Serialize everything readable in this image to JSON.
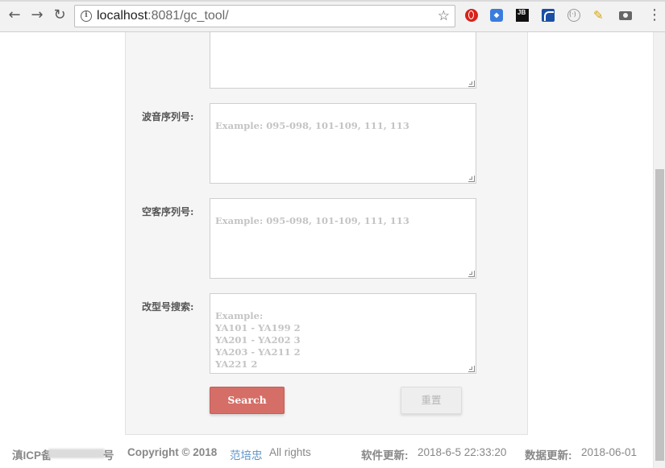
{
  "browser": {
    "url_host": "localhost",
    "url_rest": ":8081/gc_tool/",
    "extensions": [
      "opera-icon",
      "blue-extension-icon",
      "jetbrains-icon",
      "wave-extension-icon",
      "circle-extension-icon",
      "pen-extension-icon",
      "camera-icon"
    ],
    "jb_label": "JB"
  },
  "form": {
    "fields": [
      {
        "label": "",
        "placeholder": ""
      },
      {
        "label": "波音序列号:",
        "placeholder": "Example: 095-098, 101-109, 111, 113"
      },
      {
        "label": "空客序列号:",
        "placeholder": "Example: 095-098, 101-109, 111, 113"
      },
      {
        "label": "改型号搜索:",
        "placeholder": "Example:\nYA101 - YA199 2\nYA201 - YA202 3\nYA203 - YA211 2\nYA221 2"
      }
    ],
    "search_label": "Search",
    "reset_label": "重置"
  },
  "footer": {
    "icp_prefix": "滇ICP备",
    "icp_suffix": "号",
    "copyright": "Copyright © 2018",
    "author": "范培忠",
    "rights": "All rights",
    "software_update_label": "软件更新:",
    "software_update_value": "2018-6-5  22:33:20",
    "data_update_label": "数据更新:",
    "data_update_value": "2018-06-01"
  },
  "colors": {
    "search_button": "#d56e66",
    "author_link": "#5b93c9",
    "panel_bg": "#f5f5f5"
  }
}
